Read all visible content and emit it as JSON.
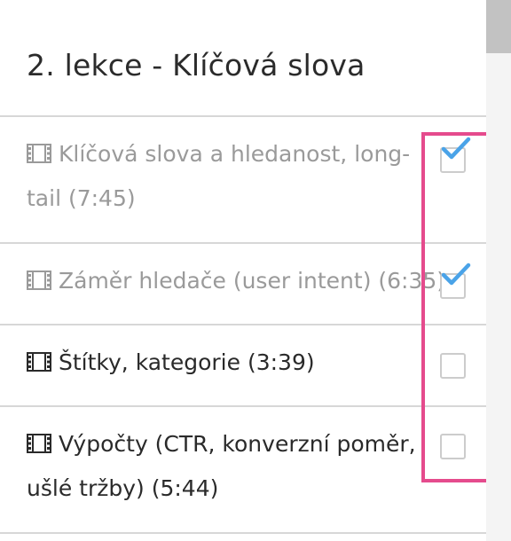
{
  "section": {
    "title": "2. lekce - Klíčová slova"
  },
  "lessons": [
    {
      "label": "Klíčová slova a hledanost, long-tail (7:45)",
      "icon": "film-icon",
      "completed": true
    },
    {
      "label": "Záměr hledače (user intent) (6:35)",
      "icon": "film-icon",
      "completed": true
    },
    {
      "label": "Štítky, kategorie (3:39)",
      "icon": "film-icon",
      "completed": false
    },
    {
      "label": "Výpočty (CTR, konverzní poměr, ušlé tržby) (5:44)",
      "icon": "film-icon",
      "completed": false
    }
  ],
  "colors": {
    "check_accent": "#4aa3e8",
    "highlight": "#e54b8d",
    "completed_text": "#9a9a9a",
    "active_text": "#2a2a2a"
  }
}
